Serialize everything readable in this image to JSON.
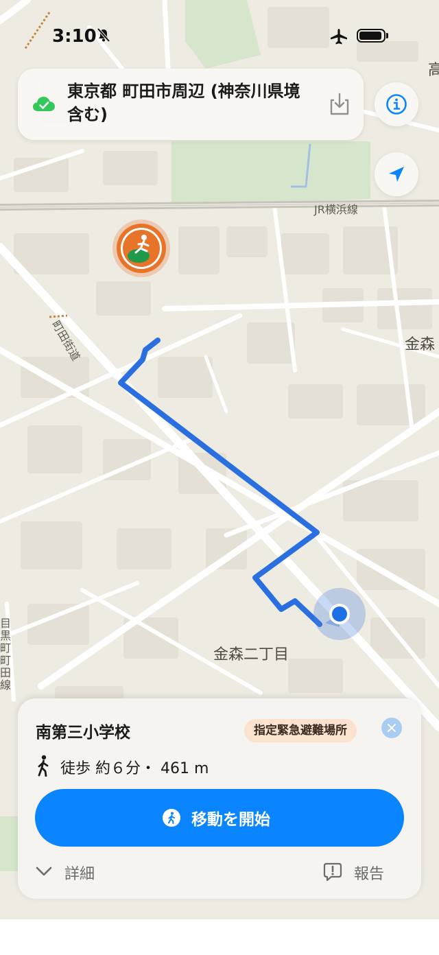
{
  "status_bar": {
    "time": "3:10"
  },
  "map": {
    "labels": {
      "railway": "JR横浜線",
      "road": "町田街道",
      "area_current": "金森二丁目",
      "area_east": "金森",
      "corner_top_right": "高",
      "left_line": "目黒町町田線"
    }
  },
  "title_card": {
    "title": "東京都 町田市周辺 (神奈川県境含む)"
  },
  "route_sheet": {
    "destination": "南第三小学校",
    "badge": "指定緊急避難場所",
    "walk_summary": "徒歩 約６分・ 461 m",
    "start_button": "移動を開始",
    "details_label": "詳細",
    "report_label": "報告"
  },
  "colors": {
    "accent": "#0a84ff",
    "route": "#2a6fe0",
    "shelter_marker": "#e8742a",
    "shelter_inner": "#1e9a4a",
    "badge_bg": "#fbe2cf",
    "map_bg": "#eeebe2",
    "park": "#d6e6cc"
  },
  "icons": [
    "bell-slash-icon",
    "airplane-icon",
    "battery-icon",
    "cloud-check-icon",
    "download-icon",
    "info-icon",
    "location-arrow-icon",
    "walking-icon",
    "close-icon",
    "chevron-down-icon",
    "report-icon",
    "shelter-icon"
  ]
}
